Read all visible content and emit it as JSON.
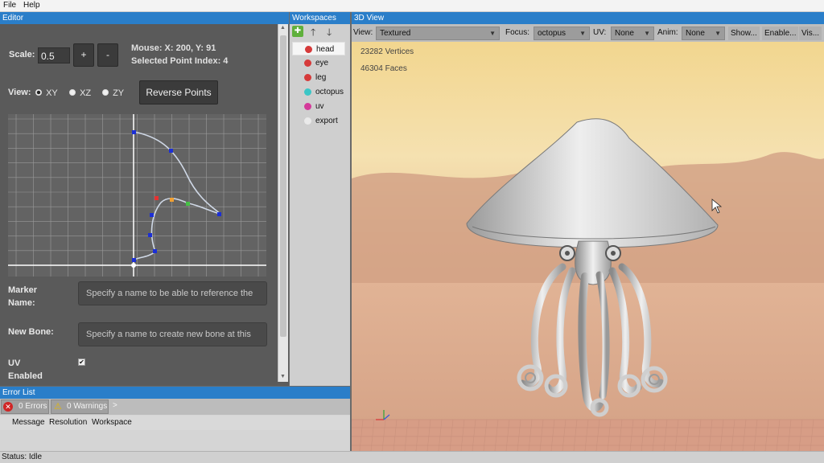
{
  "menu": {
    "file": "File",
    "help": "Help"
  },
  "editor": {
    "title": "Editor",
    "scale_label": "Scale:",
    "scale_value": "0.5",
    "plus_label": "+",
    "minus_label": "-",
    "mouse_text": "Mouse: X: 200, Y: 91",
    "selected_text": "Selected Point Index: 4",
    "view_label": "View:",
    "views": [
      "XY",
      "XZ",
      "ZY"
    ],
    "selected_view": "XY",
    "reverse_label": "Reverse Points",
    "marker_label_1": "Marker",
    "marker_label_2": "Name:",
    "marker_placeholder": "Specify a name to be able to reference the",
    "newbone_label": "New Bone:",
    "newbone_placeholder": "Specify a name to create new bone at this",
    "uv_label_1": "UV",
    "uv_label_2": "Enabled",
    "uv_enabled": true
  },
  "workspaces": {
    "title": "Workspaces",
    "items": [
      {
        "label": "head",
        "color": "#d63a3a",
        "selected": true
      },
      {
        "label": "eye",
        "color": "#d63a3a"
      },
      {
        "label": "leg",
        "color": "#d63a3a"
      },
      {
        "label": "octopus",
        "color": "#3cc6c6"
      },
      {
        "label": "uv",
        "color": "#d43a9a"
      },
      {
        "label": "export",
        "color": "#eaeaea"
      }
    ]
  },
  "view3d": {
    "title": "3D View",
    "view_label": "View:",
    "view_value": "Textured",
    "focus_label": "Focus:",
    "focus_value": "octopus",
    "uv_label": "UV:",
    "uv_value": "None",
    "anim_label": "Anim:",
    "anim_value": "None",
    "show_label": "Show...",
    "enable_label": "Enable...",
    "vis_label": "Vis...",
    "vertices": "23282 Vertices",
    "faces": "46304 Faces"
  },
  "errorlist": {
    "title": "Error List",
    "errors": "0 Errors",
    "warnings": "0 Warnings",
    "more": ">",
    "columns": [
      "Message",
      "Resolution",
      "Workspace"
    ]
  },
  "status": {
    "text": "Status: Idle"
  },
  "colors": {
    "accent": "#2a7ec9",
    "editor_bg": "#5a5a5a",
    "grid_bg": "#636363"
  }
}
